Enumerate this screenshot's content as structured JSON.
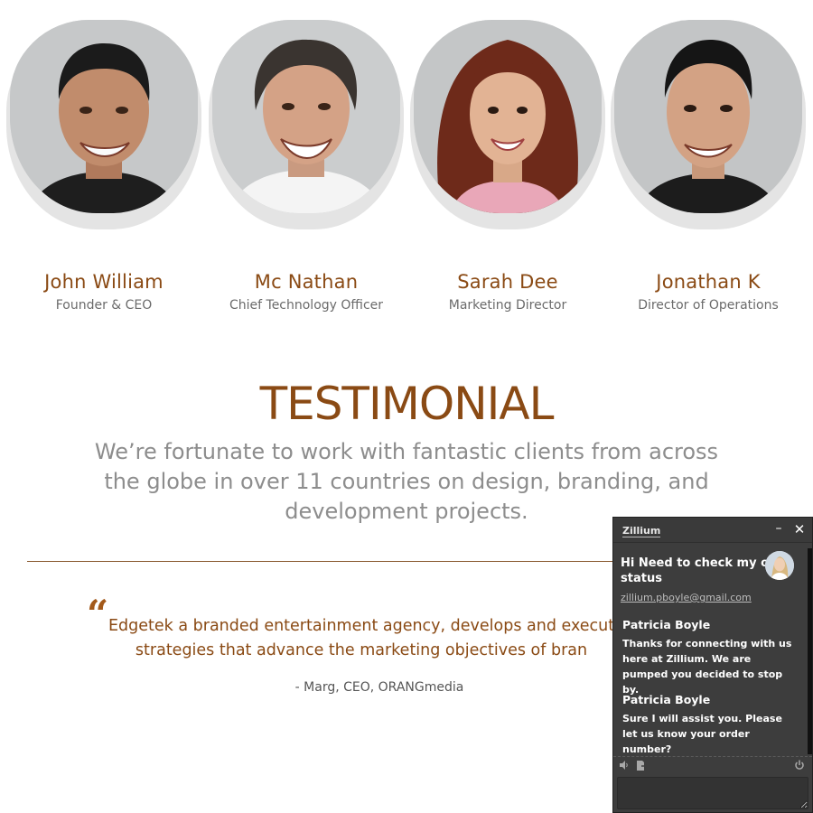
{
  "team": [
    {
      "name": "John William",
      "role": "Founder & CEO"
    },
    {
      "name": "Mc Nathan",
      "role": "Chief Technology Officer"
    },
    {
      "name": "Sarah Dee",
      "role": "Marketing Director"
    },
    {
      "name": "Jonathan K",
      "role": "Director of Operations"
    }
  ],
  "testimonial": {
    "title": "TESTIMONIAL",
    "intro": "We’re fortunate to work with fantastic clients from across the globe in over 11 countries on design, branding, and development projects.",
    "quote_mark": "“",
    "quote_line1": "Edgetek a branded entertainment agency, develops and execut",
    "quote_line2": "strategies that advance the marketing objectives of bran",
    "author": "- Marg, CEO, ORANGmedia"
  },
  "chat": {
    "brand": "Zillium",
    "minimize_icon": "minimize-icon",
    "close_icon": "close-icon",
    "minimize_glyph": "–",
    "close_glyph": "✕",
    "subject_line1": "Hi Need to check my orde",
    "subject_line2": "status",
    "email": "zillium.pboyle@gmail.com",
    "messages": [
      {
        "sender": "Patricia Boyle",
        "text": "Thanks for connecting with us here at Zillium. We are pumped you decided to stop by."
      },
      {
        "sender": "Patricia Boyle",
        "text": "Sure I will assist you. Please let us know your order number?"
      }
    ],
    "tools": {
      "sound": "speaker-icon",
      "transfer": "file-transfer-icon",
      "power": "power-icon"
    },
    "input_placeholder": ""
  },
  "colors": {
    "accent": "#8a4a14",
    "chat_bg": "#3d3d3d"
  }
}
